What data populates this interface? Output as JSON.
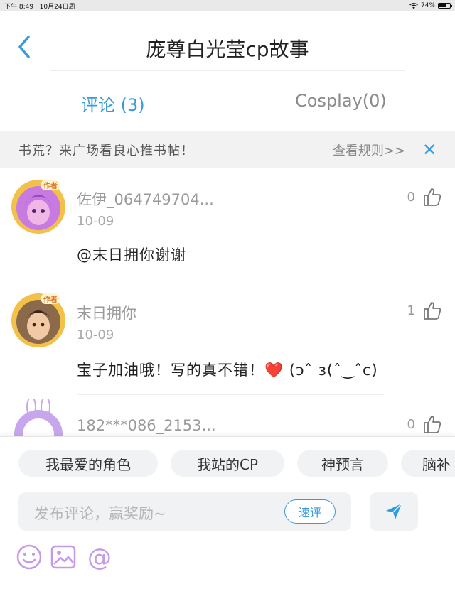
{
  "status_bar": {
    "time": "下午 8:49",
    "date": "10月24日周一",
    "battery": "74%",
    "battery_level": 0.74
  },
  "nav": {
    "title": "庞尊白光莹cp故事",
    "icons": {
      "back": "chevron-left-icon"
    }
  },
  "tabs": [
    {
      "label": "评论 (3)",
      "active": true
    },
    {
      "label": "Cosplay(0)",
      "active": false
    }
  ],
  "banner": {
    "text": "书荒？来广场看良心推书帖！",
    "link": "查看规则>>",
    "close": "✕"
  },
  "comments": [
    {
      "username": "佐伊_064749704...",
      "date": "10-09",
      "content": "@末日拥你谢谢",
      "likes": "0",
      "badge": "作者"
    },
    {
      "username": "末日拥你",
      "date": "10-09",
      "content": "宝子加油哦！写的真不错！❤️ (ɔˆ з(ˆ‿ˆc)",
      "likes": "1",
      "badge": "作者"
    },
    {
      "username": "182***086_2153...",
      "date": "",
      "content": "",
      "likes": "0",
      "badge": ""
    }
  ],
  "composer": {
    "chips": [
      "我最爱的角色",
      "我站的CP",
      "神预言",
      "脑补"
    ],
    "placeholder": "发布评论，赢奖励~",
    "quick_review": "速评",
    "tools": [
      "emoji-icon",
      "image-icon",
      "mention-icon"
    ]
  },
  "colors": {
    "accent": "#3a9ad9",
    "muted": "#9a9a9a",
    "banner_bg": "#f2f2f2"
  }
}
